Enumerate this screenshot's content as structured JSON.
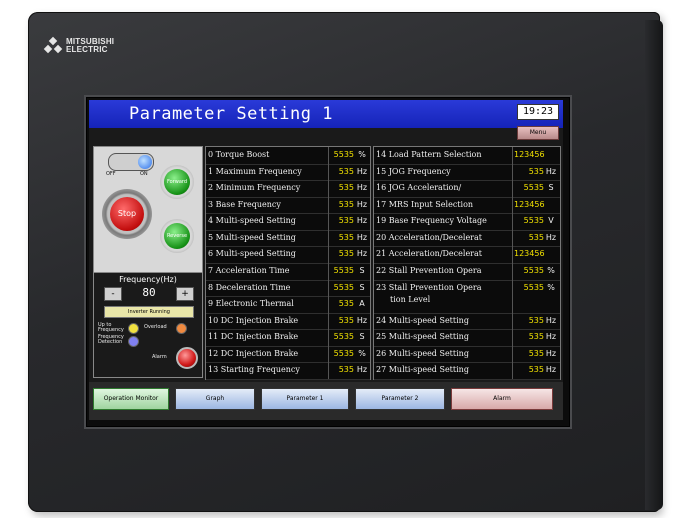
{
  "brand": {
    "line1": "MITSUBISHI",
    "line2": "ELECTRIC"
  },
  "header": {
    "title": "Parameter Setting 1",
    "clock": "19:23",
    "menu_label": "Menu"
  },
  "controls": {
    "toggle_off": "OFF",
    "toggle_on": "ON",
    "stop_label": "Stop",
    "forward_label": "Forward",
    "reverse_label": "Reverse"
  },
  "frequency": {
    "title": "Frequency(Hz)",
    "minus": "-",
    "value": "80",
    "plus": "+",
    "inverter_running": "Inverter Running",
    "up_to_frequency": "Up to Frequency",
    "frequency_detection": "Frequency Detection",
    "overload": "Overload",
    "alarm": "Alarm"
  },
  "params_left": [
    {
      "name": "0 Torque Boost",
      "value": "5535",
      "unit": "%"
    },
    {
      "name": "1 Maximum Frequency",
      "value": "535",
      "unit": "Hz"
    },
    {
      "name": "2 Minimum Frequency",
      "value": "535",
      "unit": "Hz"
    },
    {
      "name": "3 Base Frequency",
      "value": "535",
      "unit": "Hz"
    },
    {
      "name": "4 Multi-speed Setting",
      "value": "535",
      "unit": "Hz"
    },
    {
      "name": "5 Multi-speed Setting",
      "value": "535",
      "unit": "Hz"
    },
    {
      "name": "6 Multi-speed Setting",
      "value": "535",
      "unit": "Hz"
    },
    {
      "name": "7 Acceleration Time",
      "value": "5535",
      "unit": "S"
    },
    {
      "name": "8 Deceleration Time",
      "value": "5535",
      "unit": "S"
    },
    {
      "name": "9 Electronic Thermal",
      "value": "535",
      "unit": "A"
    },
    {
      "name": "10 DC Injection Brake",
      "value": "535",
      "unit": "Hz"
    },
    {
      "name": "11 DC Injection Brake",
      "value": "5535",
      "unit": "S"
    },
    {
      "name": "12 DC Injection Brake",
      "value": "5535",
      "unit": "%"
    },
    {
      "name": "13 Starting Frequency",
      "value": "535",
      "unit": "Hz"
    }
  ],
  "params_right": [
    {
      "name": "14 Load Pattern Selection",
      "value": "123456",
      "unit": ""
    },
    {
      "name": "15 JOG Frequency",
      "value": "535",
      "unit": "Hz"
    },
    {
      "name": "16 JOG Acceleration/",
      "value": "5535",
      "unit": "S"
    },
    {
      "name": "17 MRS Input Selection",
      "value": "123456",
      "unit": ""
    },
    {
      "name": "19 Base Frequency Voltage",
      "value": "5535",
      "unit": "V"
    },
    {
      "name": "20 Acceleration/Decelerat",
      "value": "535",
      "unit": "Hz"
    },
    {
      "name": "21 Acceleration/Decelerat",
      "value": "123456",
      "unit": ""
    },
    {
      "name": "22 Stall Prevention Opera",
      "value": "5535",
      "unit": "%"
    },
    {
      "name": "23 Stall Prevention Opera",
      "name2": "tion Level",
      "value": "5535",
      "unit": "%"
    },
    {
      "name": "24 Multi-speed Setting",
      "value": "535",
      "unit": "Hz"
    },
    {
      "name": "25 Multi-speed Setting",
      "value": "535",
      "unit": "Hz"
    },
    {
      "name": "26 Multi-speed Setting",
      "value": "535",
      "unit": "Hz"
    },
    {
      "name": "27 Multi-speed Setting",
      "value": "535",
      "unit": "Hz"
    }
  ],
  "nav": [
    {
      "label": "Operation Monitor",
      "color": "#bfe8bf"
    },
    {
      "label": "Graph",
      "color": "#bcd0f0"
    },
    {
      "label": "Parameter 1",
      "color": "#bcd0f0"
    },
    {
      "label": "Parameter 2",
      "color": "#bcd0f0"
    },
    {
      "label": "Alarm",
      "color": "#e8c8c8"
    }
  ],
  "colors": {
    "title_bar": "#1523b8",
    "value_text": "#f0e000",
    "lamp_on": "#f0e040",
    "lamp_overload": "#f08a40",
    "lamp_blue": "#8080f0"
  }
}
